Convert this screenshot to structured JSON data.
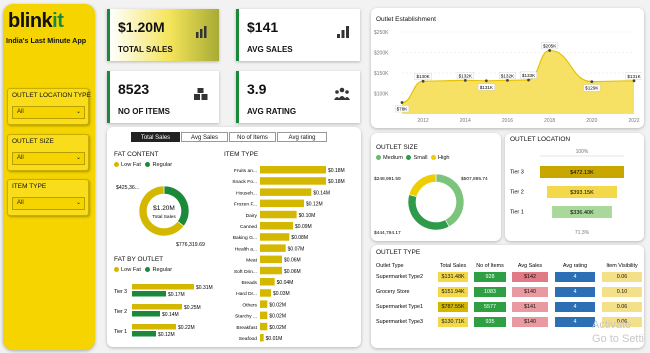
{
  "brand": {
    "logo_main": "blink",
    "logo_accent": "it",
    "tagline": "India's Last Minute App"
  },
  "filters": [
    {
      "label": "OUTLET LOCATION TYPE",
      "value": "All"
    },
    {
      "label": "OUTLET SIZE",
      "value": "All"
    },
    {
      "label": "ITEM TYPE",
      "value": "All"
    }
  ],
  "kpis": [
    {
      "value": "$1.20M",
      "label": "TOTAL SALES",
      "icon": "bar-chart-icon"
    },
    {
      "value": "$141",
      "label": "AVG SALES",
      "icon": "signal-bars-icon"
    },
    {
      "value": "8523",
      "label": "NO OF ITEMS",
      "icon": "boxes-icon"
    },
    {
      "value": "3.9",
      "label": "AVG RATING",
      "icon": "people-icon"
    }
  ],
  "tabs": [
    "Total Sales",
    "Avg Sales",
    "No of Items",
    "Avg rating"
  ],
  "colors": {
    "yellow": "#f5d400",
    "gold": "#c8a800",
    "green": "#1a8a3a",
    "lightgreen": "#7cc47c"
  },
  "fat_content": {
    "title": "FAT CONTENT",
    "legend": [
      "Low Fat",
      "Regular"
    ],
    "center_value": "$1.20M",
    "center_label": "Total Sales",
    "low_fat_label": "$776,319.69",
    "regular_label": "$425,36...",
    "chart_data": {
      "type": "pie",
      "categories": [
        "Low Fat",
        "Regular"
      ],
      "values": [
        776319.69,
        425361.8
      ]
    }
  },
  "fat_by_outlet": {
    "title": "FAT BY OUTLET",
    "legend": [
      "Low Fat",
      "Regular"
    ],
    "chart_data": {
      "type": "bar",
      "categories": [
        "Tier 3",
        "Tier 2",
        "Tier 1"
      ],
      "series": [
        {
          "name": "Low Fat",
          "values": [
            0.31,
            0.25,
            0.22
          ],
          "labels": [
            "$0.31M",
            "$0.25M",
            "$0.22M"
          ]
        },
        {
          "name": "Regular",
          "values": [
            0.17,
            0.14,
            0.12
          ],
          "labels": [
            "$0.17M",
            "$0.14M",
            "$0.12M"
          ]
        }
      ]
    }
  },
  "item_type": {
    "title": "ITEM TYPE",
    "chart_data": {
      "type": "bar",
      "categories": [
        "Fruits an...",
        "Snack Fo...",
        "Househ...",
        "Frozen F...",
        "Dairy",
        "Canned",
        "Baking G...",
        "Health a...",
        "Meat",
        "Soft Drin...",
        "Breads",
        "Hard Dr...",
        "Others",
        "Starchy ...",
        "Breakfast",
        "Seafood"
      ],
      "values": [
        0.18,
        0.18,
        0.14,
        0.12,
        0.1,
        0.09,
        0.08,
        0.07,
        0.06,
        0.06,
        0.04,
        0.03,
        0.02,
        0.02,
        0.02,
        0.01
      ],
      "labels": [
        "$0.18M",
        "$0.18M",
        "$0.14M",
        "$0.12M",
        "$0.10M",
        "$0.09M",
        "$0.08M",
        "$0.07M",
        "$0.06M",
        "$0.06M",
        "$0.04M",
        "$0.03M",
        "$0.02M",
        "$0.02M",
        "$0.02M",
        "$0.01M"
      ]
    }
  },
  "outlet_establishment": {
    "title": "Outlet Establishment",
    "chart_data": {
      "type": "area",
      "x": [
        2011,
        2012,
        2014,
        2015,
        2016,
        2017,
        2018,
        2020,
        2022
      ],
      "values": [
        78,
        130,
        132,
        131,
        132,
        133,
        205,
        129,
        131
      ],
      "labels": [
        "$78K",
        "$130K",
        "$132K",
        "$131K",
        "$132K",
        "$133K",
        "$205K",
        "$129K",
        "$131K"
      ],
      "y_ticks": [
        "$250K",
        "$200K",
        "$150K",
        "$100K"
      ],
      "x_ticks": [
        "2012",
        "2014",
        "2016",
        "2018",
        "2020",
        "2022"
      ],
      "ylim": [
        50,
        250
      ]
    }
  },
  "outlet_size": {
    "title": "OUTLET SIZE",
    "legend": [
      "Medium",
      "Small",
      "High"
    ],
    "labels": [
      "$507,895.74",
      "$444,794.17",
      "$248,991.59"
    ],
    "chart_data": {
      "type": "pie",
      "categories": [
        "Medium",
        "Small",
        "High"
      ],
      "values": [
        507895.74,
        444794.17,
        248991.59
      ]
    }
  },
  "outlet_location": {
    "title": "OUTLET LOCATION",
    "top_pct": "100%",
    "bottom_pct": "71.3%",
    "chart_data": {
      "type": "bar",
      "categories": [
        "Tier 3",
        "Tier 2",
        "Tier 1"
      ],
      "values": [
        472.13,
        393.15,
        336.4
      ],
      "labels": [
        "$472.13K",
        "$393.15K",
        "$336.40K"
      ]
    }
  },
  "outlet_type": {
    "title": "OUTLET TYPE",
    "headers": [
      "Outlet Type",
      "Total Sales",
      "No of Items",
      "Avg Sales",
      "Avg rating",
      "Item Visibility"
    ],
    "rows": [
      [
        "Supermarket Type2",
        "$131.48K",
        "928",
        "$142",
        "4",
        "0.06"
      ],
      [
        "Grocery Store",
        "$151.94K",
        "1083",
        "$140",
        "4",
        "0.10"
      ],
      [
        "Supermarket Type1",
        "$787.55K",
        "5577",
        "$141",
        "4",
        "0.06"
      ],
      [
        "Supermarket Type3",
        "$130.71K",
        "935",
        "$140",
        "4",
        "0.06"
      ]
    ]
  },
  "watermark": [
    "Activate",
    "Go to Setti"
  ]
}
